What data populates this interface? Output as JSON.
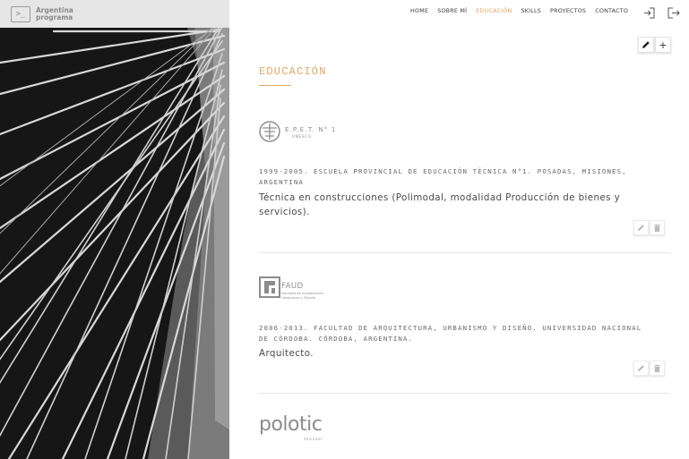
{
  "brand": {
    "logo_glyph": ">_",
    "line1": "Argentina",
    "line2": "programa"
  },
  "nav": {
    "items": [
      {
        "label": "HOME",
        "active": false
      },
      {
        "label": "SOBRE MÍ",
        "active": false
      },
      {
        "label": "EDUCACIÓN",
        "active": true
      },
      {
        "label": "SKILLS",
        "active": false
      },
      {
        "label": "PROYECTOS",
        "active": false
      },
      {
        "label": "CONTACTO",
        "active": false
      }
    ],
    "icons": [
      "login-icon",
      "logout-icon"
    ]
  },
  "section": {
    "title": "EDUCACIÓN",
    "actions": [
      "edit-icon",
      "plus-icon"
    ],
    "plus_glyph": "+"
  },
  "education": [
    {
      "logo": {
        "title": "E.P.E.T. N° 1",
        "subtitle": "UNESCO"
      },
      "meta": "1999-2005. ESCUELA PROVINCIAL DE EDUCACIÓN TÉCNICA N°1. POSADAS, MISIONES, ARGENTINA",
      "description": "Técnica en construcciones (Polimodal, modalidad Producción de bienes y servicios)."
    },
    {
      "logo": {
        "title": "FAUD",
        "subtitle_1": "Facultad de Arquitectura",
        "subtitle_2": "Urbanismo y Diseño"
      },
      "meta": "2006-2013. FACULTAD DE ARQUITECTURA, URBANISMO Y DISEÑO. UNIVERSIDAD NACIONAL DE CÓRDOBA. CÓRDOBA, ARGENTINA.",
      "description": "Arquitecto."
    },
    {
      "logo": {
        "title": "polotic",
        "subtitle": "misiones"
      }
    }
  ],
  "colors": {
    "accent": "#e0a860",
    "hero_bg": "#1a1a1a",
    "brand_bar": "#e6e6e6"
  }
}
